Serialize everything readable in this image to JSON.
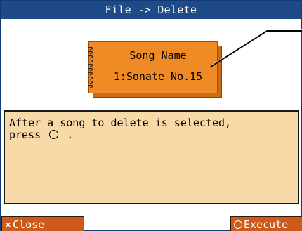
{
  "window": {
    "title": "File -> Delete"
  },
  "song": {
    "label": "Song Name",
    "value": "1:Sonate No.15"
  },
  "message": {
    "text_before": "After a song to delete is selected,\npress",
    "text_after": " ."
  },
  "buttons": {
    "close_label": "Close",
    "execute_label": "Execute"
  },
  "icons": {
    "close": "x-icon",
    "execute": "circle-icon",
    "spiral": "spiral-binding-icon"
  },
  "colors": {
    "title_bar": "#1e4a87",
    "card": "#f08a24",
    "panel": "#f8d9a8",
    "button": "#cc5a1a"
  }
}
